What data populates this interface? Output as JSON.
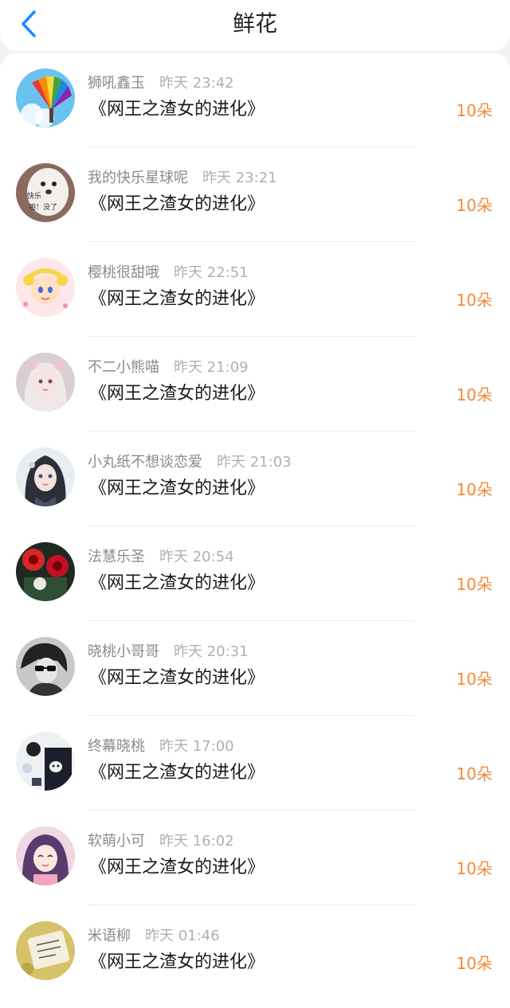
{
  "header": {
    "title": "鲜花",
    "back_icon": "chevron-left-icon",
    "accent": "#1a8cff"
  },
  "amount_color": "#f08a3a",
  "items": [
    {
      "user": "狮吼鑫玉",
      "time": "昨天 23:42",
      "book": "《网王之渣女的进化》",
      "amount": "10朵"
    },
    {
      "user": "我的快乐星球呢",
      "time": "昨天 23:21",
      "book": "《网王之渣女的进化》",
      "amount": "10朵"
    },
    {
      "user": "樱桃很甜哦",
      "time": "昨天 22:51",
      "book": "《网王之渣女的进化》",
      "amount": "10朵"
    },
    {
      "user": "不二小熊喵",
      "time": "昨天 21:09",
      "book": "《网王之渣女的进化》",
      "amount": "10朵"
    },
    {
      "user": "小丸纸不想谈恋爱",
      "time": "昨天 21:03",
      "book": "《网王之渣女的进化》",
      "amount": "10朵"
    },
    {
      "user": "法慧乐圣",
      "time": "昨天 20:54",
      "book": "《网王之渣女的进化》",
      "amount": "10朵"
    },
    {
      "user": "晓桃小哥哥",
      "time": "昨天 20:31",
      "book": "《网王之渣女的进化》",
      "amount": "10朵"
    },
    {
      "user": "终幕晓桃",
      "time": "昨天 17:00",
      "book": "《网王之渣女的进化》",
      "amount": "10朵"
    },
    {
      "user": "软萌小可",
      "time": "昨天 16:02",
      "book": "《网王之渣女的进化》",
      "amount": "10朵"
    },
    {
      "user": "米语柳",
      "time": "昨天 01:46",
      "book": "《网王之渣女的进化》",
      "amount": "10朵"
    }
  ]
}
